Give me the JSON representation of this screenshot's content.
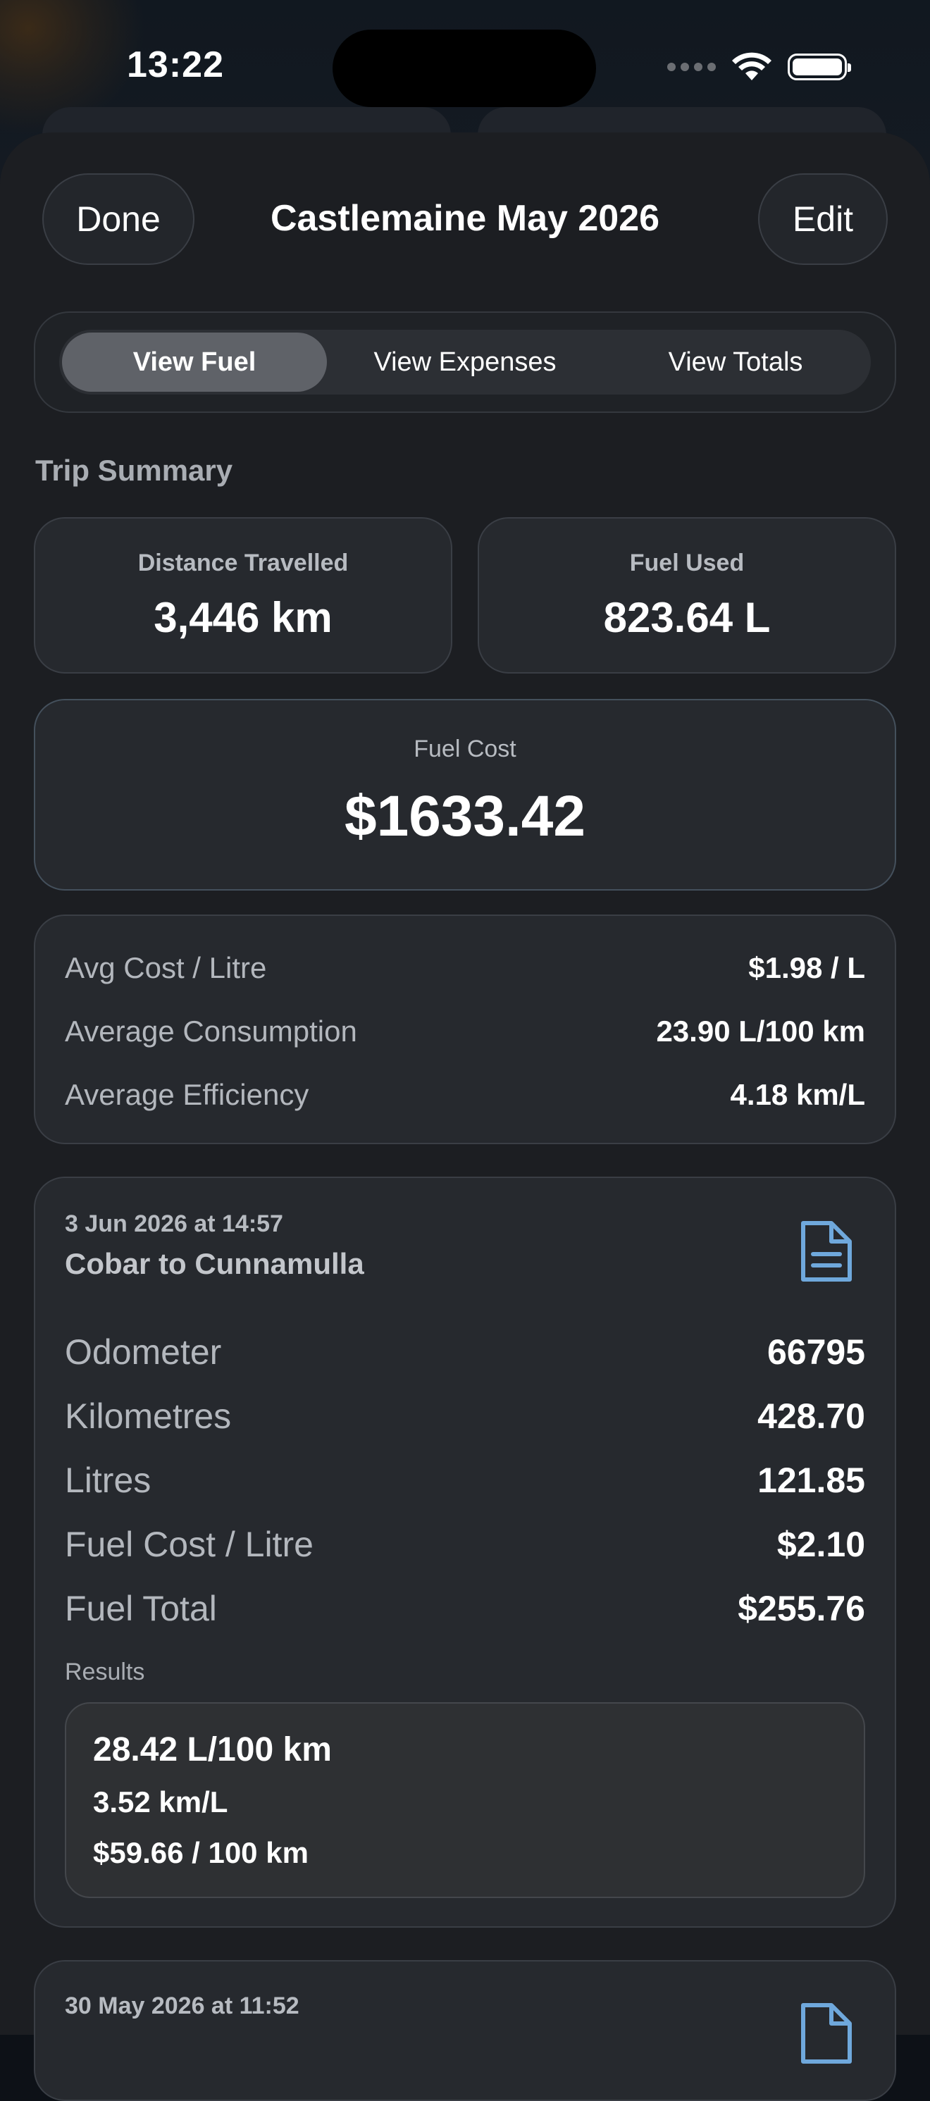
{
  "status_bar": {
    "time": "13:22"
  },
  "nav": {
    "done_label": "Done",
    "title": "Castlemaine May 2026",
    "edit_label": "Edit"
  },
  "segments": {
    "fuel": "View Fuel",
    "expenses": "View Expenses",
    "totals": "View Totals",
    "selected": "View Fuel"
  },
  "summary": {
    "section_title": "Trip Summary",
    "distance_label": "Distance Travelled",
    "distance_value": "3,446 km",
    "fuel_used_label": "Fuel Used",
    "fuel_used_value": "823.64 L",
    "fuel_cost_label": "Fuel Cost",
    "fuel_cost_value": "$1633.42"
  },
  "averages": {
    "avg_cost_label": "Avg Cost / Litre",
    "avg_cost_value": "$1.98 / L",
    "avg_consumption_label": "Average Consumption",
    "avg_consumption_value": "23.90 L/100 km",
    "avg_efficiency_label": "Average Efficiency",
    "avg_efficiency_value": "4.18 km/L"
  },
  "entries": [
    {
      "date": "3 Jun 2026 at 14:57",
      "title": "Cobar to Cunnamulla",
      "icon": "document-icon",
      "odometer_label": "Odometer",
      "odometer_value": "66795",
      "km_label": "Kilometres",
      "km_value": "428.70",
      "litres_label": "Litres",
      "litres_value": "121.85",
      "cost_per_litre_label": "Fuel Cost / Litre",
      "cost_per_litre_value": "$2.10",
      "fuel_total_label": "Fuel Total",
      "fuel_total_value": "$255.76",
      "results_label": "Results",
      "results": [
        "28.42 L/100 km",
        "3.52 km/L",
        "$59.66 / 100 km"
      ]
    },
    {
      "date": "30 May 2026 at 11:52",
      "icon": "document-icon"
    }
  ],
  "colors": {
    "accent_icon": "#6fa8dc",
    "sheet": "#1c1e22",
    "card": "#26292e"
  }
}
